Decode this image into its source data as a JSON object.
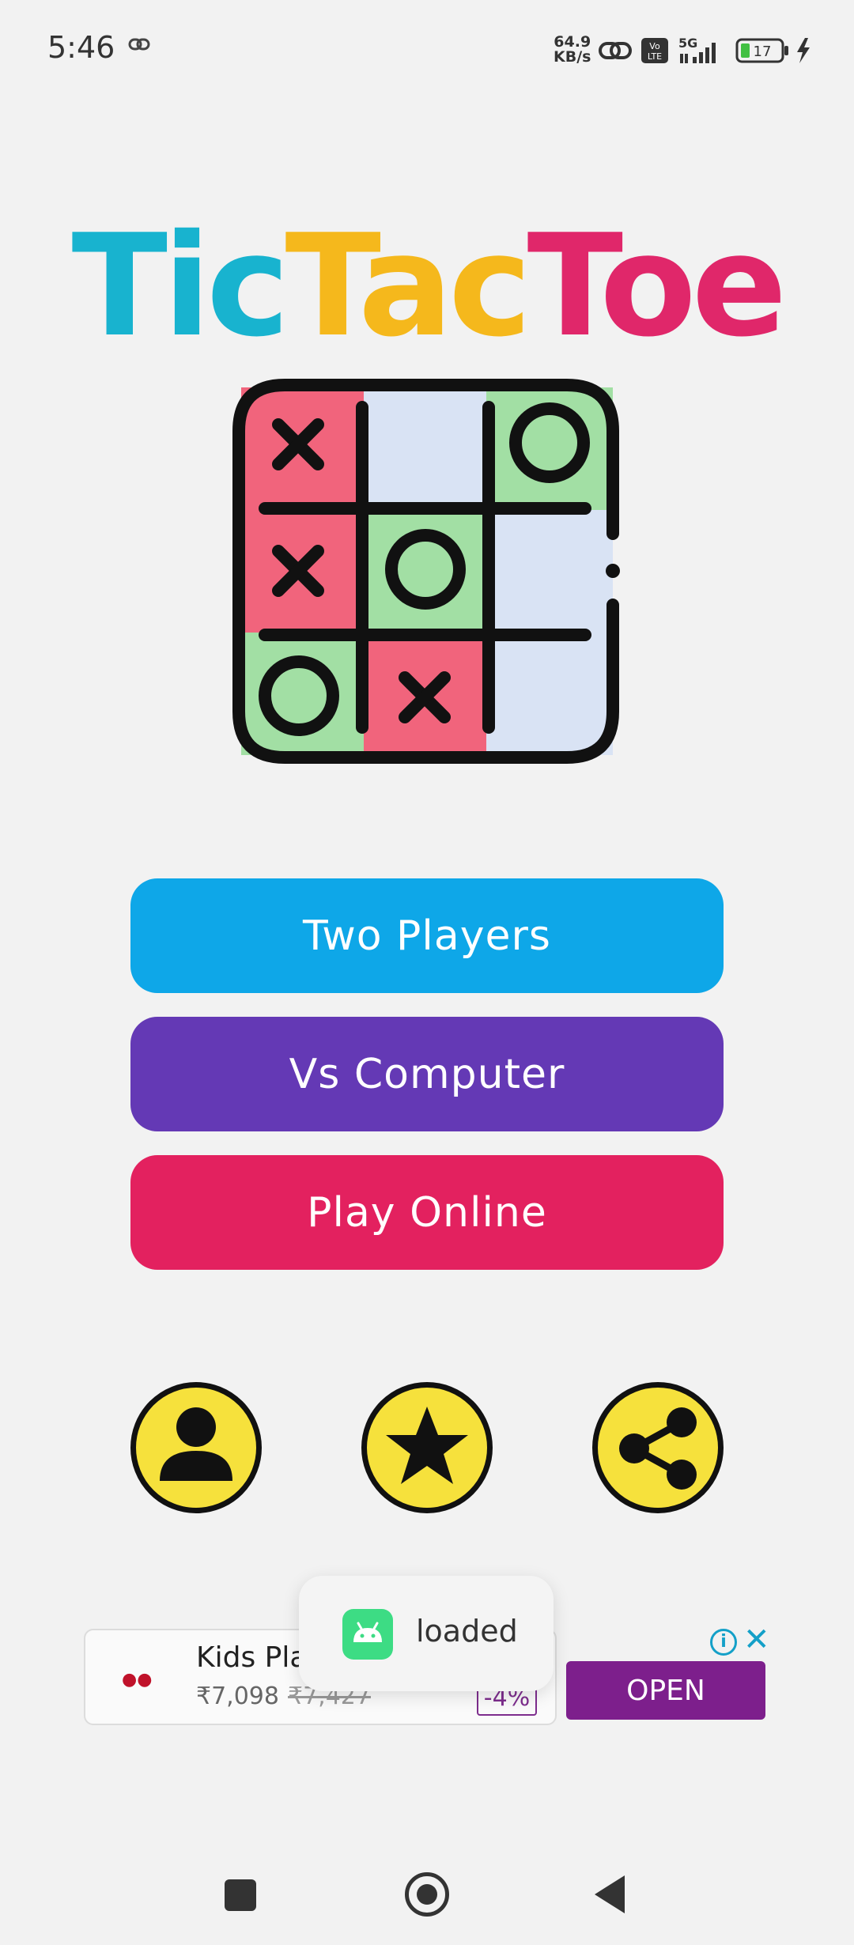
{
  "status_bar": {
    "time": "5:46",
    "net_speed_value": "64.9",
    "net_speed_unit": "KB/s",
    "network": "5G",
    "battery": "17"
  },
  "title": {
    "part1": "Tic",
    "part2": "Tac",
    "part3": "Toe",
    "color1": "#18b3cf",
    "color2": "#f5b81c",
    "color3": "#e0276a"
  },
  "menu": {
    "two_players": "Two Players",
    "vs_computer": "Vs Computer",
    "play_online": "Play Online"
  },
  "icons": [
    "profile-icon",
    "star-icon",
    "share-icon"
  ],
  "ad": {
    "title": "Kids Pla",
    "price": "₹7,098",
    "old_price": "₹7,427",
    "discount": "-4%",
    "open_label": "OPEN",
    "info_glyph": "i",
    "close_glyph": "✕"
  },
  "toast": {
    "text": "loaded"
  },
  "colors": {
    "two_players": "#0ea7e8",
    "vs_computer": "#6439b5",
    "play_online": "#e3215f",
    "icon_fill": "#f6e13c",
    "ad_open": "#7d1f8c"
  }
}
